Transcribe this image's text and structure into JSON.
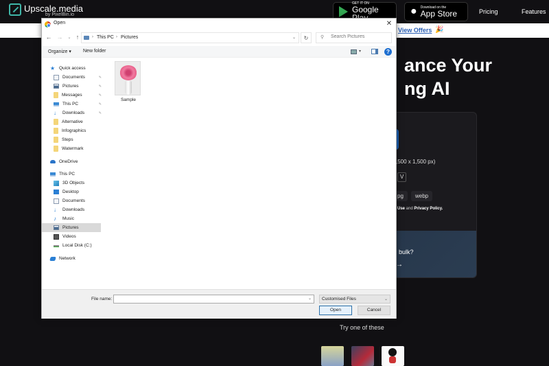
{
  "site": {
    "logo_text": "Upscale.media",
    "logo_sub": "by PixelBin.io",
    "google_play": {
      "small": "GET IT ON",
      "big": "Google Play"
    },
    "app_store": {
      "small": "Download on the",
      "big": "App Store"
    },
    "nav": {
      "pricing": "Pricing",
      "features": "Features"
    },
    "promo": {
      "link": "View Offers",
      "icon": "🎉"
    },
    "hero": {
      "line1": "ance Your",
      "line2": "ng AI"
    },
    "card": {
      "resolution": ",500 x 1,500 px)",
      "chip": "V",
      "formats": [
        "pg",
        "webp"
      ],
      "terms_prefix": "Use",
      "terms_and": " and ",
      "terms_privacy": "Privacy Policy.",
      "bulk_text": "bulk?",
      "bulk_arrow": "→"
    },
    "try_text": "Try one of these"
  },
  "dialog": {
    "title": "Open",
    "close": "✕",
    "nav": {
      "back": "←",
      "forward": "→",
      "recent": "⌄",
      "up": "↑",
      "refresh": "↻"
    },
    "breadcrumb": [
      "This PC",
      "Pictures"
    ],
    "crumb_sep": "›",
    "search_placeholder": "Search Pictures",
    "toolbar": {
      "organize": "Organize ▾",
      "new_folder": "New folder",
      "help": "?"
    },
    "sidebar": {
      "quick_access": "Quick access",
      "quick_items": [
        {
          "label": "Documents",
          "pinned": true
        },
        {
          "label": "Pictures",
          "pinned": true
        },
        {
          "label": "Messages",
          "pinned": true
        },
        {
          "label": "This PC",
          "pinned": true
        },
        {
          "label": "Downloads",
          "pinned": true
        },
        {
          "label": "Alternative"
        },
        {
          "label": "Infographics"
        },
        {
          "label": "Steps"
        },
        {
          "label": "Watermark"
        }
      ],
      "onedrive": "OneDrive",
      "this_pc": "This PC",
      "pc_items": [
        "3D Objects",
        "Desktop",
        "Documents",
        "Downloads",
        "Music",
        "Pictures",
        "Videos",
        "Local Disk (C:)"
      ],
      "selected": "Pictures",
      "network": "Network",
      "pin_glyph": "📌"
    },
    "files": [
      {
        "name": "Sample"
      }
    ],
    "footer": {
      "file_name_label": "File name:",
      "file_name_value": "",
      "file_type": "Customised Files",
      "open": "Open",
      "cancel": "Cancel"
    }
  }
}
